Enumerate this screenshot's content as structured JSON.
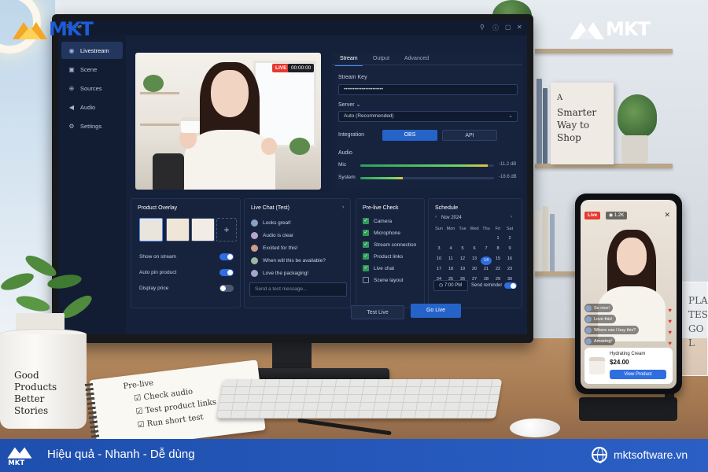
{
  "brand": {
    "name": "MKT",
    "tagline": "Hiệu quả - Nhanh - Dễ dùng",
    "website": "mktsoftware.vn",
    "colors": {
      "primary": "#2563c9",
      "orange": "#f5a623",
      "live_red": "#e6392f"
    }
  },
  "app": {
    "scene_label": "Scene",
    "sidebar": [
      {
        "label": "Livestream",
        "icon": "broadcast-icon",
        "active": true
      },
      {
        "label": "Scene",
        "icon": "image-icon",
        "active": false
      },
      {
        "label": "Sources",
        "icon": "sources-icon",
        "active": false
      },
      {
        "label": "Audio",
        "icon": "speaker-icon",
        "active": false
      },
      {
        "label": "Settings",
        "icon": "gear-icon",
        "active": false
      }
    ],
    "preview": {
      "live_label": "LIVE",
      "timer": "00:00:00"
    },
    "settings_panel": {
      "tabs": [
        "Stream",
        "Output",
        "Advanced"
      ],
      "active_tab": "Stream",
      "stream_key_label": "Stream Key",
      "stream_key_value": "••••••••••••••••••••••",
      "server_label": "Server",
      "server_value": "Auto (Recommended)",
      "integration_label": "Integration",
      "integration_options": [
        "OBS",
        "API"
      ],
      "integration_selected": "OBS",
      "audio_label": "Audio",
      "audio_channels": [
        {
          "name": "Mic",
          "db": "-11.2 dB",
          "level": 0.95
        },
        {
          "name": "System",
          "db": "-18.6 dB",
          "level": 0.32
        }
      ]
    },
    "product_overlay": {
      "title": "Product Overlay",
      "toggles": [
        {
          "label": "Show on stream",
          "on": true
        },
        {
          "label": "Auto pin product",
          "on": true
        },
        {
          "label": "Display price",
          "on": false
        }
      ]
    },
    "live_chat": {
      "title": "Live Chat (Test)",
      "messages": [
        "Looks great!",
        "Audio is clear",
        "Excited for this!",
        "When will this be available?",
        "Love the packaging!"
      ],
      "input_placeholder": "Send a test message..."
    },
    "prelive_check": {
      "title": "Pre-live Check",
      "items": [
        {
          "label": "Camera",
          "checked": true
        },
        {
          "label": "Microphone",
          "checked": true
        },
        {
          "label": "Stream connection",
          "checked": true
        },
        {
          "label": "Product links",
          "checked": true
        },
        {
          "label": "Live chat",
          "checked": true
        },
        {
          "label": "Scene layout",
          "checked": false
        }
      ]
    },
    "schedule": {
      "title": "Schedule",
      "month": "Nov 2024",
      "weekdays": [
        "Sun",
        "Mon",
        "Tue",
        "Wed",
        "Thu",
        "Fri",
        "Sat"
      ],
      "weeks": [
        [
          "",
          "",
          "",
          "",
          "",
          "1",
          "2"
        ],
        [
          "3",
          "4",
          "5",
          "6",
          "7",
          "8",
          "9"
        ],
        [
          "10",
          "11",
          "12",
          "13",
          "14",
          "15",
          "16"
        ],
        [
          "17",
          "18",
          "19",
          "20",
          "21",
          "22",
          "23"
        ],
        [
          "24",
          "25",
          "26",
          "27",
          "28",
          "29",
          "30"
        ]
      ],
      "selected_day": "14",
      "time": "7:00 PM",
      "reminder_label": "Send reminder",
      "reminder_on": true
    },
    "actions": {
      "test": "Test Live",
      "go": "Go Live"
    }
  },
  "phone": {
    "live_label": "Live",
    "viewers": "1.2K",
    "comments": [
      "So nice!",
      "Love this!",
      "Where can I buy this?",
      "Amazing!"
    ],
    "product_name": "Hydrating Cream",
    "price": "$24.00",
    "button": "View Product"
  },
  "props": {
    "sign_lines": [
      "A",
      "Smarter",
      "Way to",
      "Shop"
    ],
    "mug_lines": [
      "Good",
      "Products",
      "Better",
      "Stories"
    ],
    "notebook_lines": [
      "Pre-live",
      "☑ Check audio",
      "☑ Test product links",
      "☑ Run short test"
    ],
    "acrylic_lines": [
      "PLA",
      "TEST",
      "GO L"
    ]
  }
}
